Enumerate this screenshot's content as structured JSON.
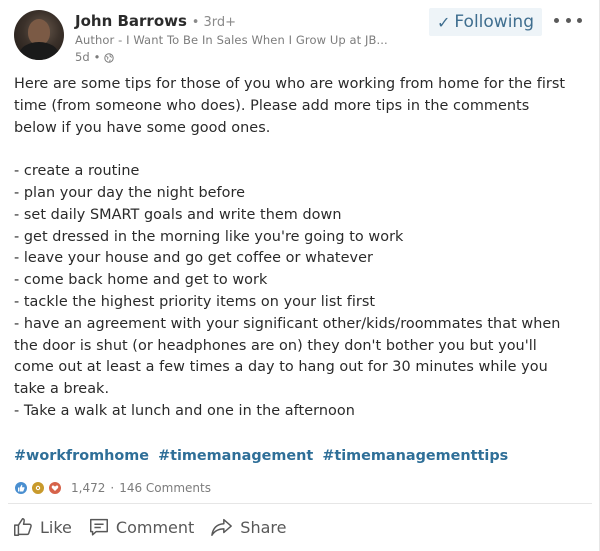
{
  "author": {
    "name": "John Barrows",
    "degree": "3rd+",
    "headline": "Author - I Want To Be In Sales When I Grow Up at JB...",
    "time": "5d"
  },
  "header": {
    "follow_label": "Following"
  },
  "post": {
    "intro": [
      "Here are some tips for those of you who are working from home for the first",
      "time (from someone who does). Please add more tips in the comments",
      "below if you have some good ones."
    ],
    "tips": [
      "- create a routine",
      "- plan your day the night before",
      "- set daily SMART goals and write them down",
      "- get dressed in the morning like you're going to work",
      "- leave your house and go get coffee or whatever",
      "- come back home and get to work",
      "- tackle the highest priority items on your list first",
      "- have an agreement with your significant other/kids/roommates that when",
      "the door is shut (or headphones are on) they don't bother you but you'll",
      "come out at least a few times a day to hang out for 30 minutes while you",
      "take a break.",
      "- Take a walk at lunch and one in the afternoon"
    ],
    "hashtags": [
      "#workfromhome",
      "#timemanagement",
      "#timemanagementtips"
    ]
  },
  "social": {
    "reactions_count": "1,472",
    "separator": "·",
    "comments_label": "146 Comments",
    "reaction_icons": [
      "like-reaction-icon",
      "celebrate-reaction-icon",
      "love-reaction-icon"
    ]
  },
  "actions": {
    "like_label": "Like",
    "comment_label": "Comment",
    "share_label": "Share"
  },
  "colors": {
    "link": "#2f6f98",
    "follow": "#3f6e8f",
    "text": "#2a2a2a",
    "muted": "#7c7c7c"
  }
}
